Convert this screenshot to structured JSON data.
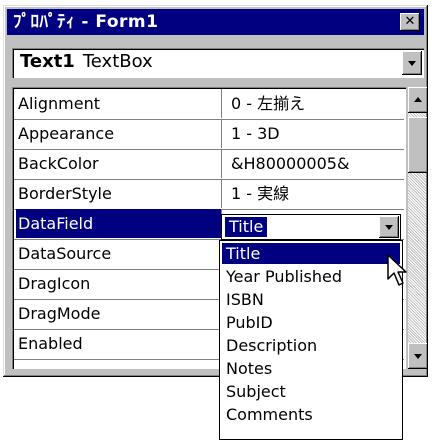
{
  "window": {
    "title": "ﾌﾟﾛﾊﾟﾃｨ - Form1",
    "close_glyph": "✕"
  },
  "object": {
    "name": "Text1",
    "type": "TextBox"
  },
  "properties": [
    {
      "name": "Alignment",
      "value": "0 - 左揃え"
    },
    {
      "name": "Appearance",
      "value": "1 - 3D"
    },
    {
      "name": "BackColor",
      "value": "&H80000005&"
    },
    {
      "name": "BorderStyle",
      "value": "1 - 実線"
    },
    {
      "name": "DataField",
      "value": ""
    },
    {
      "name": "DataSource",
      "value": ""
    },
    {
      "name": "DragIcon",
      "value": ""
    },
    {
      "name": "DragMode",
      "value": ""
    },
    {
      "name": "Enabled",
      "value": ""
    }
  ],
  "selected_property": "DataField",
  "datafield_combo": {
    "value": "Title"
  },
  "datafield_options": [
    "Title",
    "Year Published",
    "ISBN",
    "PubID",
    "Description",
    "Notes",
    "Subject",
    "Comments"
  ],
  "highlighted_option": "Title",
  "colors": {
    "titlebar": "#000080",
    "selection": "#000080",
    "face": "#c0c0c0"
  }
}
